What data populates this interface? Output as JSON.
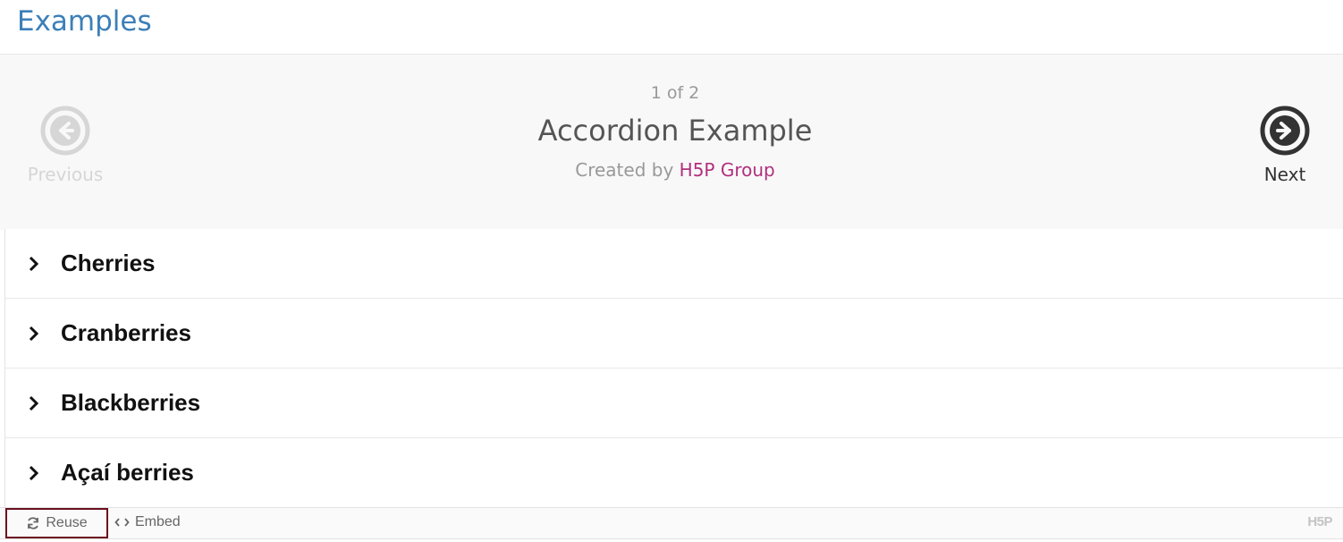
{
  "page": {
    "title": "Examples"
  },
  "navigation": {
    "counter": "1 of 2",
    "content_title": "Accordion Example",
    "byline_prefix": "Created by",
    "author": "H5P Group",
    "previous_label": "Previous",
    "next_label": "Next",
    "previous_icon": "arrow-left-circle-icon",
    "next_icon": "arrow-right-circle-icon"
  },
  "accordion": {
    "items": [
      {
        "label": "Cherries",
        "icon": "chevron-right-icon"
      },
      {
        "label": "Cranberries",
        "icon": "chevron-right-icon"
      },
      {
        "label": "Blackberries",
        "icon": "chevron-right-icon"
      },
      {
        "label": "Açaí berries",
        "icon": "chevron-right-icon"
      }
    ]
  },
  "footer": {
    "reuse_label": "Reuse",
    "embed_label": "Embed",
    "logo_text": "H5P",
    "reuse_icon": "refresh-icon",
    "embed_icon": "code-icon"
  },
  "colors": {
    "title_blue": "#3c7fb8",
    "author_magenta": "#b0307e",
    "reuse_border": "#6b0f1f",
    "disabled_gray": "#d6d6d6",
    "next_dark": "#333333"
  }
}
